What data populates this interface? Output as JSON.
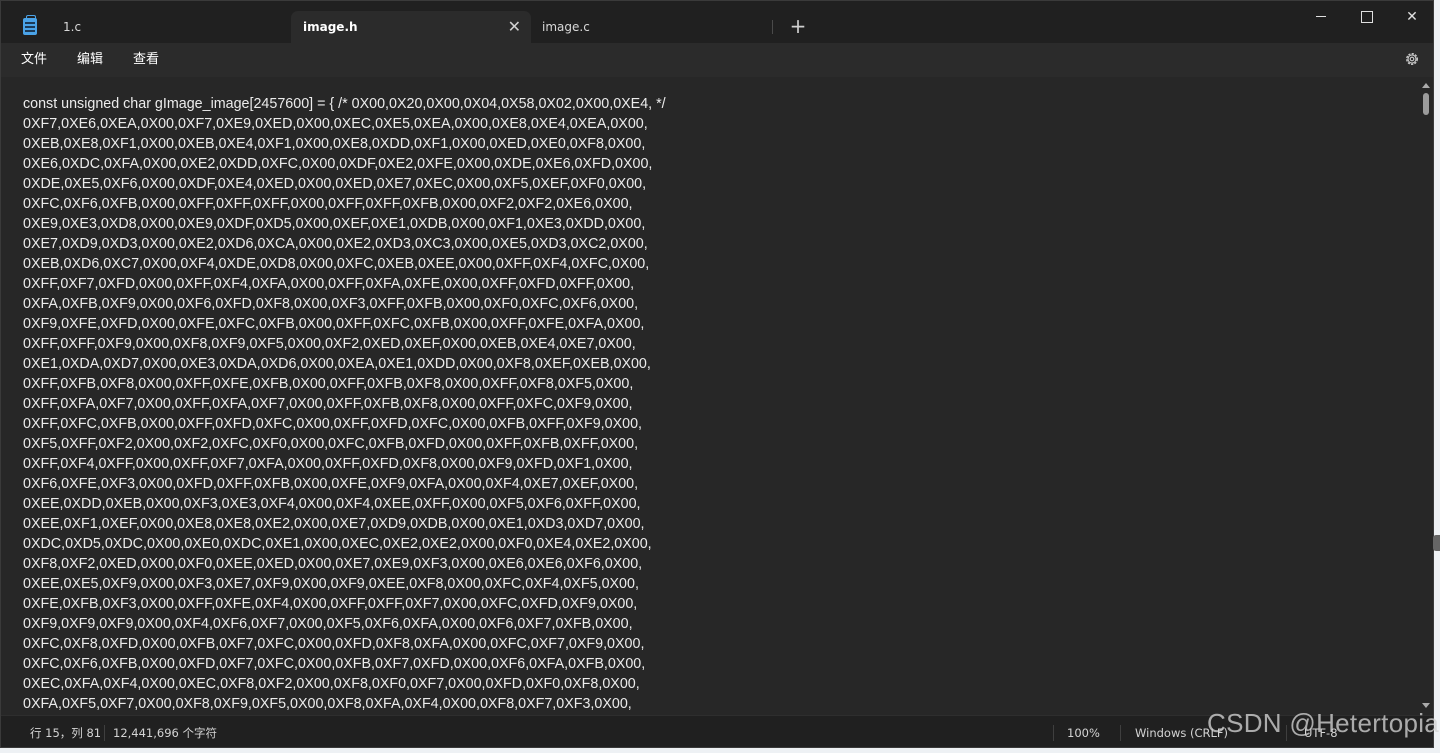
{
  "tabs": [
    {
      "label": "1.c",
      "active": false
    },
    {
      "label": "image.h",
      "active": true
    },
    {
      "label": "image.c",
      "active": false
    }
  ],
  "new_tab_label": "+",
  "window_buttons": {
    "close": "✕"
  },
  "menu": [
    "文件",
    "编辑",
    "查看"
  ],
  "settings_icon": "gear-icon",
  "editor": {
    "lines": [
      "const unsigned char gImage_image[2457600] = { /* 0X00,0X20,0X00,0X04,0X58,0X02,0X00,0XE4, */",
      "0XF7,0XE6,0XEA,0X00,0XF7,0XE9,0XED,0X00,0XEC,0XE5,0XEA,0X00,0XE8,0XE4,0XEA,0X00,",
      "0XEB,0XE8,0XF1,0X00,0XEB,0XE4,0XF1,0X00,0XE8,0XDD,0XF1,0X00,0XED,0XE0,0XF8,0X00,",
      "0XE6,0XDC,0XFA,0X00,0XE2,0XDD,0XFC,0X00,0XDF,0XE2,0XFE,0X00,0XDE,0XE6,0XFD,0X00,",
      "0XDE,0XE5,0XF6,0X00,0XDF,0XE4,0XED,0X00,0XED,0XE7,0XEC,0X00,0XF5,0XEF,0XF0,0X00,",
      "0XFC,0XF6,0XFB,0X00,0XFF,0XFF,0XFF,0X00,0XFF,0XFF,0XFB,0X00,0XF2,0XF2,0XE6,0X00,",
      "0XE9,0XE3,0XD8,0X00,0XE9,0XDF,0XD5,0X00,0XEF,0XE1,0XDB,0X00,0XF1,0XE3,0XDD,0X00,",
      "0XE7,0XD9,0XD3,0X00,0XE2,0XD6,0XCA,0X00,0XE2,0XD3,0XC3,0X00,0XE5,0XD3,0XC2,0X00,",
      "0XEB,0XD6,0XC7,0X00,0XF4,0XDE,0XD8,0X00,0XFC,0XEB,0XEE,0X00,0XFF,0XF4,0XFC,0X00,",
      "0XFF,0XF7,0XFD,0X00,0XFF,0XF4,0XFA,0X00,0XFF,0XFA,0XFE,0X00,0XFF,0XFD,0XFF,0X00,",
      "0XFA,0XFB,0XF9,0X00,0XF6,0XFD,0XF8,0X00,0XF3,0XFF,0XFB,0X00,0XF0,0XFC,0XF6,0X00,",
      "0XF9,0XFE,0XFD,0X00,0XFE,0XFC,0XFB,0X00,0XFF,0XFC,0XFB,0X00,0XFF,0XFE,0XFA,0X00,",
      "0XFF,0XFF,0XF9,0X00,0XF8,0XF9,0XF5,0X00,0XF2,0XED,0XEF,0X00,0XEB,0XE4,0XE7,0X00,",
      "0XE1,0XDA,0XD7,0X00,0XE3,0XDA,0XD6,0X00,0XEA,0XE1,0XDD,0X00,0XF8,0XEF,0XEB,0X00,",
      "0XFF,0XFB,0XF8,0X00,0XFF,0XFE,0XFB,0X00,0XFF,0XFB,0XF8,0X00,0XFF,0XF8,0XF5,0X00,",
      "0XFF,0XFA,0XF7,0X00,0XFF,0XFA,0XF7,0X00,0XFF,0XFB,0XF8,0X00,0XFF,0XFC,0XF9,0X00,",
      "0XFF,0XFC,0XFB,0X00,0XFF,0XFD,0XFC,0X00,0XFF,0XFD,0XFC,0X00,0XFB,0XFF,0XF9,0X00,",
      "0XF5,0XFF,0XF2,0X00,0XF2,0XFC,0XF0,0X00,0XFC,0XFB,0XFD,0X00,0XFF,0XFB,0XFF,0X00,",
      "0XFF,0XF4,0XFF,0X00,0XFF,0XF7,0XFA,0X00,0XFF,0XFD,0XF8,0X00,0XF9,0XFD,0XF1,0X00,",
      "0XF6,0XFE,0XF3,0X00,0XFD,0XFF,0XFB,0X00,0XFE,0XF9,0XFA,0X00,0XF4,0XE7,0XEF,0X00,",
      "0XEE,0XDD,0XEB,0X00,0XF3,0XE3,0XF4,0X00,0XF4,0XEE,0XFF,0X00,0XF5,0XF6,0XFF,0X00,",
      "0XEE,0XF1,0XEF,0X00,0XE8,0XE8,0XE2,0X00,0XE7,0XD9,0XDB,0X00,0XE1,0XD3,0XD7,0X00,",
      "0XDC,0XD5,0XDC,0X00,0XE0,0XDC,0XE1,0X00,0XEC,0XE2,0XE2,0X00,0XF0,0XE4,0XE2,0X00,",
      "0XF8,0XF2,0XED,0X00,0XF0,0XEE,0XED,0X00,0XE7,0XE9,0XF3,0X00,0XE6,0XE6,0XF6,0X00,",
      "0XEE,0XE5,0XF9,0X00,0XF3,0XE7,0XF9,0X00,0XF9,0XEE,0XF8,0X00,0XFC,0XF4,0XF5,0X00,",
      "0XFE,0XFB,0XF3,0X00,0XFF,0XFE,0XF4,0X00,0XFF,0XFF,0XF7,0X00,0XFC,0XFD,0XF9,0X00,",
      "0XF9,0XF9,0XF9,0X00,0XF4,0XF6,0XF7,0X00,0XF5,0XF6,0XFA,0X00,0XF6,0XF7,0XFB,0X00,",
      "0XFC,0XF8,0XFD,0X00,0XFB,0XF7,0XFC,0X00,0XFD,0XF8,0XFA,0X00,0XFC,0XF7,0XF9,0X00,",
      "0XFC,0XF6,0XFB,0X00,0XFD,0XF7,0XFC,0X00,0XFB,0XF7,0XFD,0X00,0XF6,0XFA,0XFB,0X00,",
      "0XEC,0XFA,0XF4,0X00,0XEC,0XF8,0XF2,0X00,0XF8,0XF0,0XF7,0X00,0XFD,0XF0,0XF8,0X00,",
      "0XFA,0XF5,0XF7,0X00,0XF8,0XF9,0XF5,0X00,0XF8,0XFA,0XF4,0X00,0XF8,0XF7,0XF3,0X00,"
    ]
  },
  "status": {
    "position": "行 15，列 81",
    "char_count": "12,441,696 个字符",
    "zoom": "100%",
    "line_ending": "Windows (CRLF)",
    "encoding": "UTF-8"
  },
  "watermark": "CSDN @Hetertopia",
  "colors": {
    "background": "#202020",
    "editor": "#272727",
    "text": "#ececec"
  }
}
